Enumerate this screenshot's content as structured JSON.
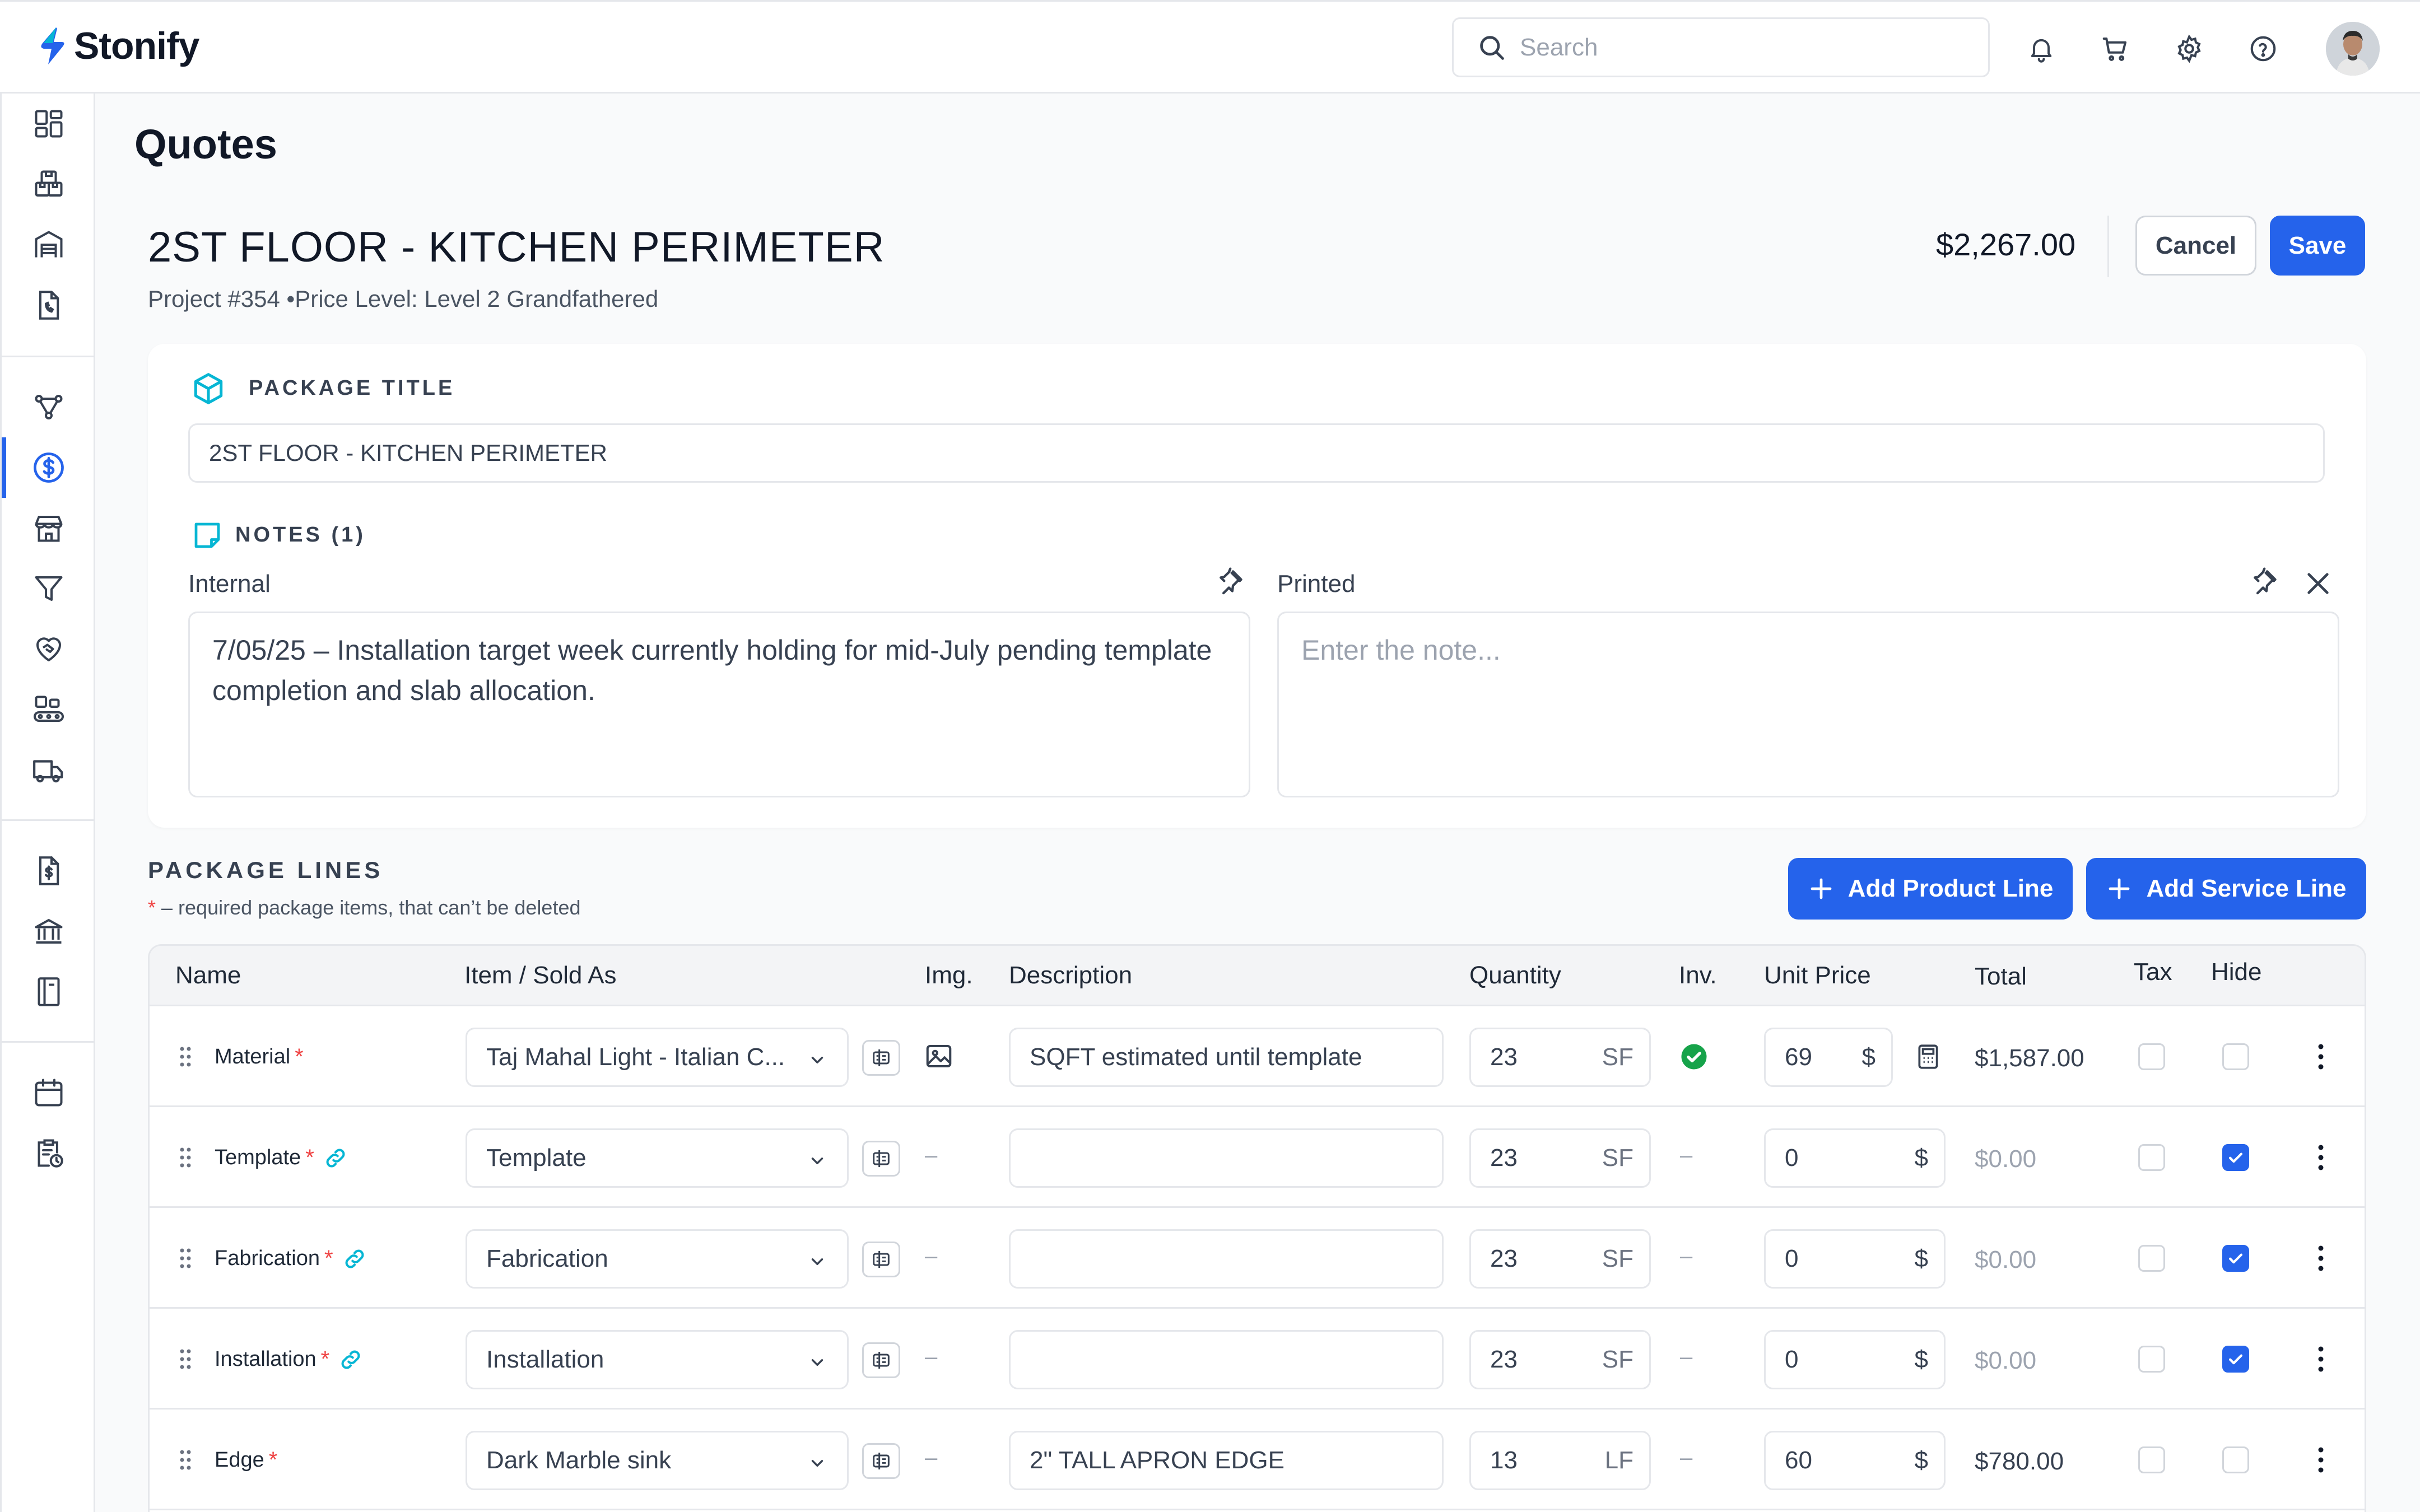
{
  "header": {
    "brand": "Stonify",
    "search_placeholder": "Search"
  },
  "page": {
    "title": "Quotes"
  },
  "quote": {
    "title": "2ST FLOOR - KITCHEN PERIMETER",
    "subtitle": "Project #354 •Price Level: Level 2 Grandfathered",
    "total": "$2,267.00",
    "cancel_label": "Cancel",
    "save_label": "Save"
  },
  "package": {
    "section_label": "PACKAGE TITLE",
    "title_value": "2ST FLOOR - KITCHEN PERIMETER",
    "notes_label": "NOTES (1)",
    "internal_label": "Internal",
    "internal_text": "7/05/25 – Installation target week currently holding for mid-July pending template completion and slab allocation.",
    "printed_label": "Printed",
    "printed_placeholder": "Enter the note..."
  },
  "lines": {
    "title": "PACKAGE LINES",
    "required_star": "*",
    "required_note": " – required package items, that can’t be deleted",
    "add_product_label": "Add Product Line",
    "add_service_label": "Add Service Line",
    "columns": {
      "name": "Name",
      "item": "Item / Sold As",
      "img": "Img.",
      "description": "Description",
      "quantity": "Quantity",
      "inv": "Inv.",
      "unit_price": "Unit Price",
      "total": "Total",
      "tax": "Tax",
      "hide": "Hide"
    },
    "rows": [
      {
        "name": "Material",
        "required": "*",
        "linked": false,
        "item": "Taj Mahal Light - Italian C...",
        "img": "image-icon",
        "description": "SQFT estimated until template",
        "quantity": "23",
        "unit": "SF",
        "inv": "check",
        "unit_price": "69",
        "currency": "$",
        "calc": true,
        "total": "$1,587.00",
        "tax": false,
        "hide": false
      },
      {
        "name": "Template",
        "required": "*",
        "linked": true,
        "item": "Template",
        "img": "–",
        "description": "",
        "quantity": "23",
        "unit": "SF",
        "inv": "–",
        "unit_price": "0",
        "currency": "$",
        "calc": false,
        "total": "$0.00",
        "tax": false,
        "hide": true
      },
      {
        "name": "Fabrication",
        "required": "*",
        "linked": true,
        "item": "Fabrication",
        "img": "–",
        "description": "",
        "quantity": "23",
        "unit": "SF",
        "inv": "–",
        "unit_price": "0",
        "currency": "$",
        "calc": false,
        "total": "$0.00",
        "tax": false,
        "hide": true
      },
      {
        "name": "Installation",
        "required": "*",
        "linked": true,
        "item": "Installation",
        "img": "–",
        "description": "",
        "quantity": "23",
        "unit": "SF",
        "inv": "–",
        "unit_price": "0",
        "currency": "$",
        "calc": false,
        "total": "$0.00",
        "tax": false,
        "hide": true
      },
      {
        "name": "Edge",
        "required": "*",
        "linked": false,
        "item": "Dark Marble sink",
        "img": "–",
        "description": "2\" TALL APRON EDGE",
        "quantity": "13",
        "unit": "LF",
        "inv": "–",
        "unit_price": "60",
        "currency": "$",
        "calc": false,
        "total": "$780.00",
        "tax": false,
        "hide": false
      }
    ]
  },
  "colors": {
    "accent": "#2563eb",
    "teal": "#06b6d4",
    "success": "#16a34a",
    "danger": "#ef4444"
  }
}
